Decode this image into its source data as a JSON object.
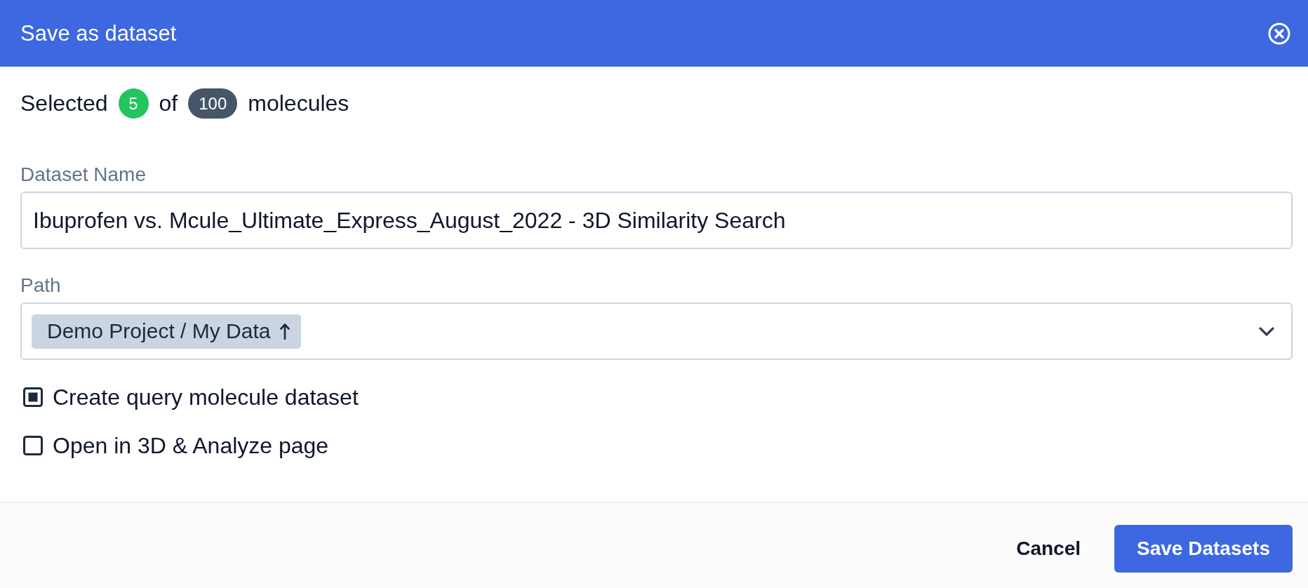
{
  "dialog": {
    "title": "Save as dataset"
  },
  "selection": {
    "prefix": "Selected",
    "selected_count": "5",
    "middle": "of",
    "total_count": "100",
    "suffix": "molecules"
  },
  "fields": [
    {
      "kind": "text",
      "label": "Dataset Name",
      "value": "Ibuprofen vs. Mcule_Ultimate_Express_August_2022 - 3D Similarity Search"
    },
    {
      "kind": "select",
      "label": "Path",
      "tags": [
        {
          "label": "Demo Project / My Data"
        }
      ]
    }
  ],
  "options": [
    {
      "label": "Create query molecule dataset",
      "checked": true
    },
    {
      "label": "Open in 3D & Analyze page",
      "checked": false
    }
  ],
  "buttons": [
    {
      "label": "Cancel",
      "kind": "text"
    },
    {
      "label": "Save Datasets",
      "kind": "primary"
    }
  ]
}
